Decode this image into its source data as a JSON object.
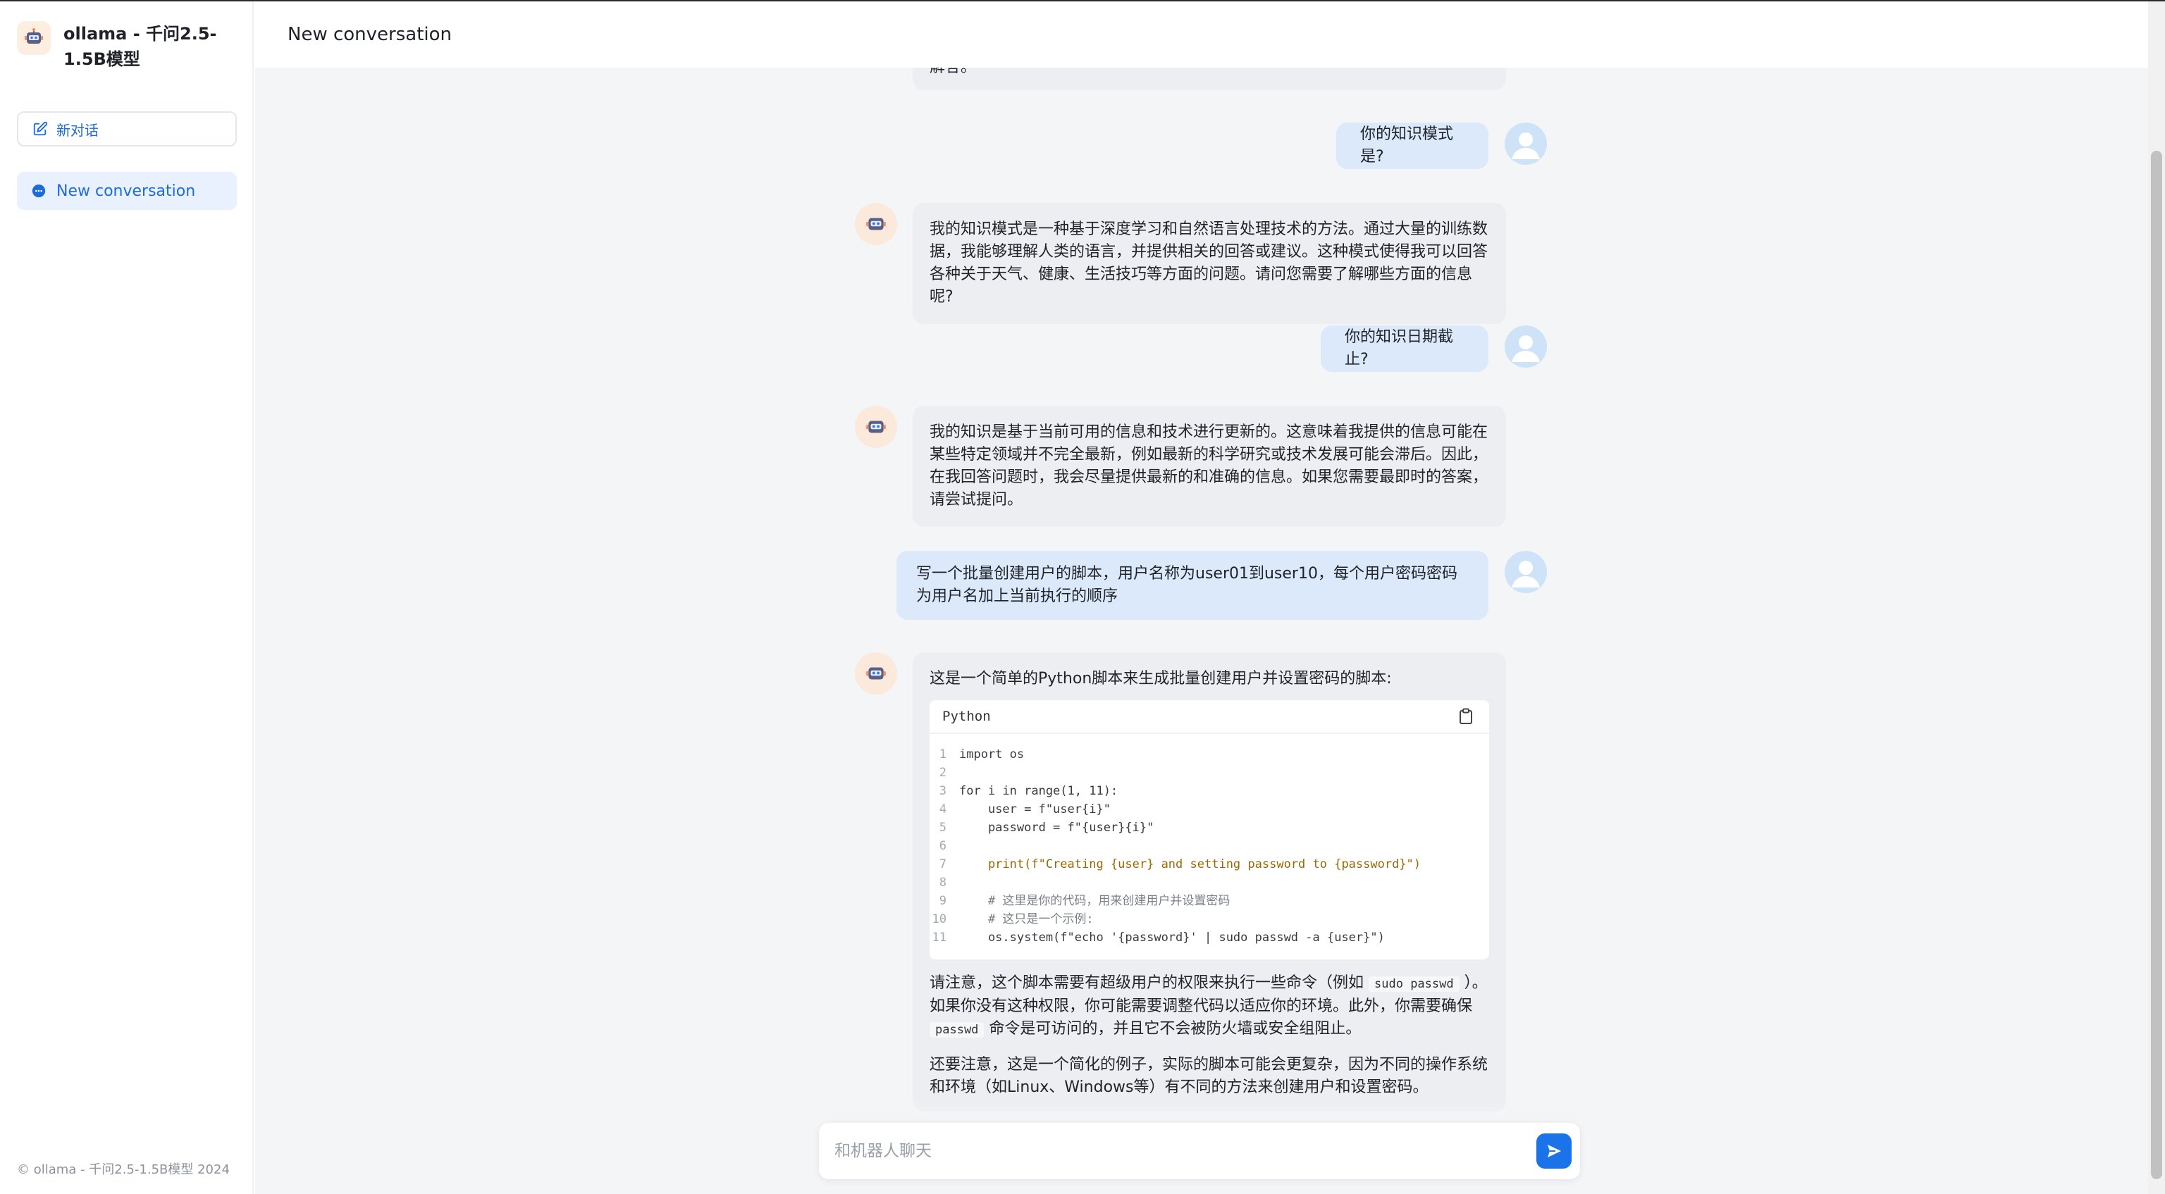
{
  "app": {
    "title": "ollama - 千问2.5-1.5B模型",
    "copyright": "© ollama - 千问2.5-1.5B模型 2024"
  },
  "sidebar": {
    "new_chat_label": "新对话",
    "conversations": [
      {
        "label": "New conversation",
        "active": true
      }
    ]
  },
  "header": {
    "title": "New conversation"
  },
  "messages": {
    "m0_text": "解答。",
    "m1_text": "你的知识模式是?",
    "m2_text": "我的知识模式是一种基于深度学习和自然语言处理技术的方法。通过大量的训练数据，我能够理解人类的语言，并提供相关的回答或建议。这种模式使得我可以回答各种关于天气、健康、生活技巧等方面的问题。请问您需要了解哪些方面的信息呢?",
    "m3_text": "你的知识日期截止?",
    "m4_text": "我的知识是基于当前可用的信息和技术进行更新的。这意味着我提供的信息可能在某些特定领域并不完全最新，例如最新的科学研究或技术发展可能会滞后。因此，在我回答问题时，我会尽量提供最新的和准确的信息。如果您需要最即时的答案，请尝试提问。",
    "m5_text": "写一个批量创建用户的脚本，用户名称为user01到user10，每个用户密码密码为用户名加上当前执行的顺序",
    "m6_intro": "这是一个简单的Python脚本来生成批量创建用户并设置密码的脚本:",
    "m6_code_lang": "Python",
    "m6_code_lines": [
      "import os",
      "",
      "for i in range(1, 11):",
      "    user = f\"user{i}\"",
      "    password = f\"{user}{i}\"",
      "",
      "    print(f\"Creating {user} and setting password to {password}\")",
      "",
      "    # 这里是你的代码，用来创建用户并设置密码",
      "    # 这只是一个示例:",
      "    os.system(f\"echo '{password}' | sudo passwd -a {user}\")"
    ],
    "m6_p2_a": "请注意，这个脚本需要有超级用户的权限来执行一些命令（例如",
    "m6_p2_code1": "sudo passwd",
    "m6_p2_b": "）。如果你没有这种权限，你可能需要调整代码以适应你的环境。此外，你需要确保",
    "m6_p2_code2": "passwd",
    "m6_p2_c": "命令是可访问的，并且它不会被防火墙或安全组阻止。",
    "m6_p3": "还要注意，这是一个简化的例子，实际的脚本可能会更复杂，因为不同的操作系统和环境（如Linux、Windows等）有不同的方法来创建用户和设置密码。"
  },
  "composer": {
    "placeholder": "和机器人聊天"
  },
  "colors": {
    "accent": "#1a73e8",
    "user_bubble": "#dbe9fb",
    "bot_bubble": "#eceef2"
  },
  "icons": {
    "brand": "robot-icon",
    "new_chat": "edit-icon",
    "conversation": "chat-bubble-icon",
    "copy": "clipboard-icon",
    "send": "send-icon"
  }
}
